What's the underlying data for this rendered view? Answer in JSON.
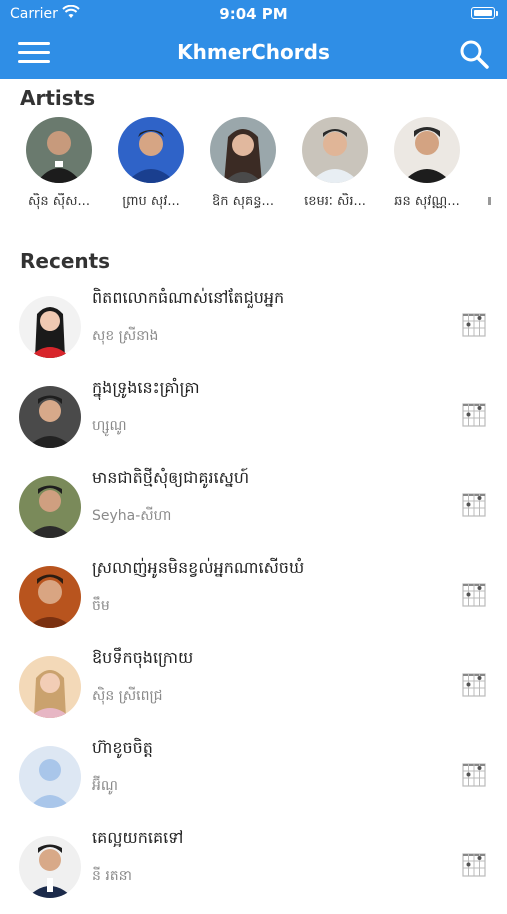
{
  "status": {
    "carrier": "Carrier",
    "time": "9:04 PM"
  },
  "header": {
    "title": "KhmerChords"
  },
  "sections": {
    "artists_title": "Artists",
    "recents_title": "Recents"
  },
  "artists": [
    {
      "name": "ស៊ិន ស៊ីស..."
    },
    {
      "name": "ព្រាប សុវ..."
    },
    {
      "name": "ឱក សុគន្ធ..."
    },
    {
      "name": "ខេមរៈ សិរ..."
    },
    {
      "name": "ឆន សុវណ្ណ..."
    }
  ],
  "recents": [
    {
      "song": "ពិតពលោកធំណាស់នៅតែជួបអ្នក",
      "artist": "សុខ ស្រីនាង"
    },
    {
      "song": "ក្នុងទ្រូងនេះគ្រាំគ្រា",
      "artist": "ហ្សូណូ"
    },
    {
      "song": "មានជាតិថ្មីសុំឲ្យជាគូរស្នេហ៍",
      "artist": "Seyha-សីហា"
    },
    {
      "song": "ស្រលាញ់អូនមិនខ្វល់អ្នកណាសើចឃំ",
      "artist": "ចឹម"
    },
    {
      "song": "ឱបទឹកចុងក្រោយ",
      "artist": "ស៊ិន ស្រីពេជ្រ"
    },
    {
      "song": "ហ៊ាខូចចិត្ត",
      "artist": "អ៊ីណូ"
    },
    {
      "song": "គេល្អយកគេទៅ",
      "artist": "នី រតនា"
    }
  ],
  "colors": {
    "header": "#2f8ee6",
    "secondary_text": "#8a8a8a"
  },
  "icons": {
    "menu": "hamburger-icon",
    "search": "search-icon",
    "chord": "guitar-chord-icon",
    "wifi": "wifi-icon",
    "battery": "battery-icon"
  }
}
